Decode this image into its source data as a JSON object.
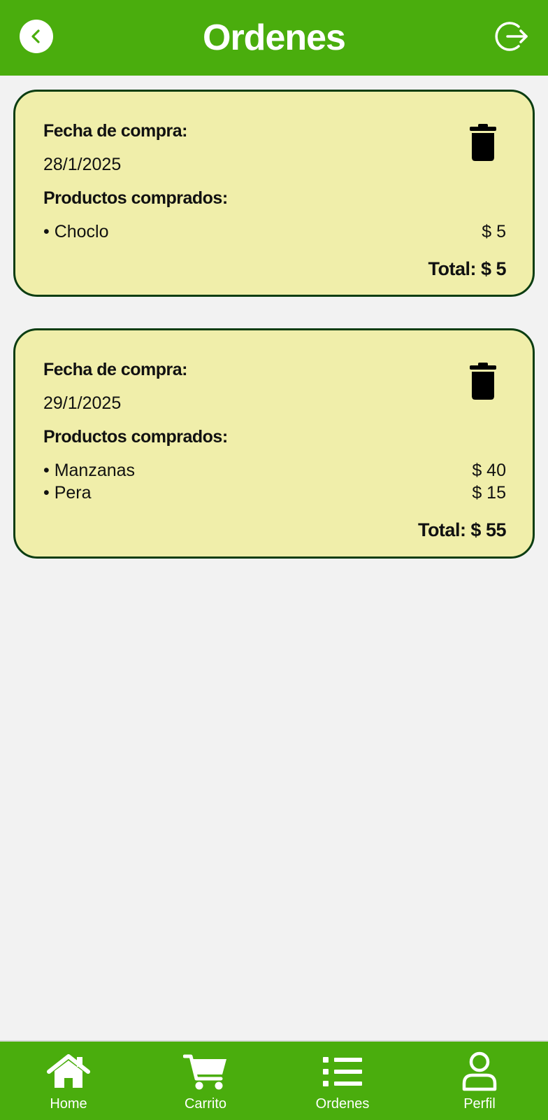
{
  "header": {
    "title": "Ordenes",
    "back_icon": "chevron-left-circle-icon",
    "logout_icon": "logout-icon"
  },
  "colors": {
    "primary": "#4aad0d",
    "card_background": "#f0eeaa",
    "card_border": "#0b3d12",
    "page_background": "#f2f2f2"
  },
  "orders": [
    {
      "date_label": "Fecha de compra:",
      "date": "28/1/2025",
      "products_label": "Productos comprados:",
      "items": [
        {
          "name": "• Choclo",
          "price": "$ 5"
        }
      ],
      "total": "Total: $ 5",
      "delete_icon": "trash-icon"
    },
    {
      "date_label": "Fecha de compra:",
      "date": "29/1/2025",
      "products_label": "Productos comprados:",
      "items": [
        {
          "name": "• Manzanas",
          "price": "$ 40"
        },
        {
          "name": "• Pera",
          "price": "$ 15"
        }
      ],
      "total": "Total: $ 55",
      "delete_icon": "trash-icon"
    }
  ],
  "bottom_nav": [
    {
      "label": "Home",
      "icon": "home-icon"
    },
    {
      "label": "Carrito",
      "icon": "cart-icon"
    },
    {
      "label": "Ordenes",
      "icon": "list-icon"
    },
    {
      "label": "Perfil",
      "icon": "user-icon"
    }
  ]
}
